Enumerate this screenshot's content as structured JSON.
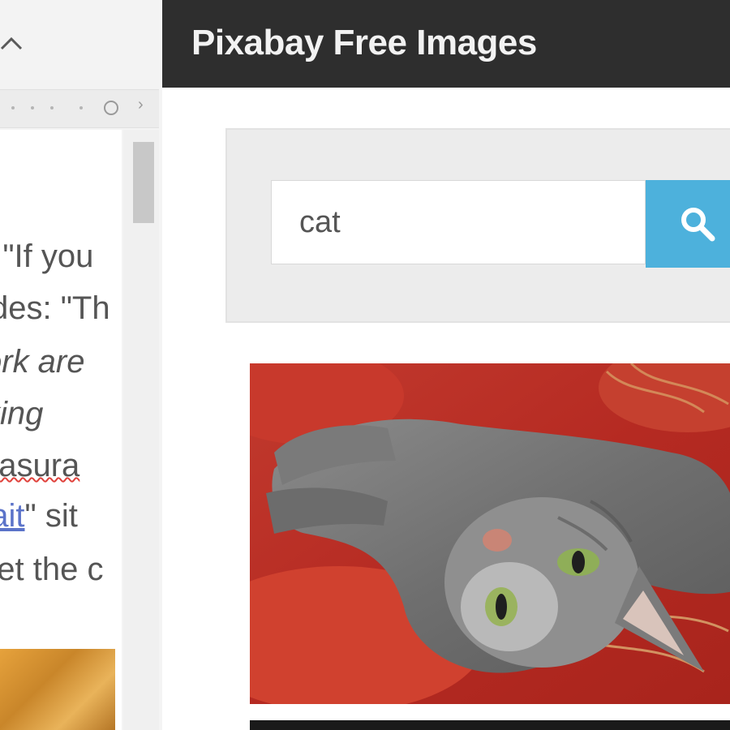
{
  "left_pane": {
    "doc_lines": [
      {
        "text": "n \"If you",
        "italic": false
      },
      {
        "text": "des: \"Th",
        "italic": false
      },
      {
        "text": "ork are",
        "italic": true
      },
      {
        "text": "king",
        "italic": true
      },
      {
        "text": "easura",
        "italic": false
      },
      {
        "link": "bait",
        "rest": "\" sit"
      },
      {
        "text": "get the c",
        "italic": false
      }
    ]
  },
  "right_pane": {
    "site_title": "Pixabay Free Images",
    "search": {
      "value": "cat"
    },
    "result": {
      "alt": "cat"
    }
  },
  "colors": {
    "header_bg": "#2e2e2e",
    "search_button": "#4db1dc",
    "search_panel_bg": "#ececec",
    "link": "#5b73c9",
    "spellcheck": "#e0423c"
  },
  "icons": {
    "collapse": "chevron-up-icon",
    "search": "search-icon",
    "settings": "gear-icon"
  }
}
